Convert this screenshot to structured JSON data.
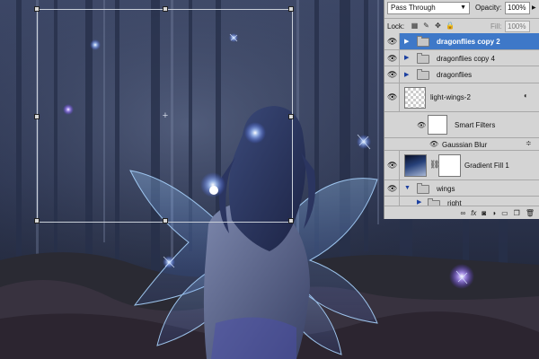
{
  "layers_panel": {
    "blend_mode": "Pass Through",
    "opacity_label": "Opacity:",
    "opacity_value": "100%",
    "lock_label": "Lock:",
    "fill_label": "Fill:",
    "fill_value": "100%",
    "layers": [
      {
        "name": "dragonflies copy 2",
        "type": "group",
        "selected": true
      },
      {
        "name": "dragonflies copy 4",
        "type": "group",
        "selected": false
      },
      {
        "name": "dragonflies",
        "type": "group",
        "selected": false
      },
      {
        "name": "light-wings-2",
        "type": "smart-object",
        "selected": false
      },
      {
        "name": "Smart Filters",
        "type": "smart-filters",
        "selected": false
      },
      {
        "name": "Gaussian Blur",
        "type": "filter",
        "selected": false
      },
      {
        "name": "Gradient Fill 1",
        "type": "fill",
        "selected": false
      },
      {
        "name": "wings",
        "type": "group-open",
        "selected": false
      },
      {
        "name": "right",
        "type": "group",
        "selected": false
      }
    ],
    "bottom_icons": [
      "link-icon",
      "fx-icon",
      "mask-icon",
      "adjustment-icon",
      "folder-icon",
      "new-layer-icon",
      "trash-icon"
    ]
  },
  "colors": {
    "selection": "#3e78c8",
    "panel_bg": "#d4d4d4",
    "forest_dark": "#1a2033",
    "glow": "#7fb0ff"
  }
}
